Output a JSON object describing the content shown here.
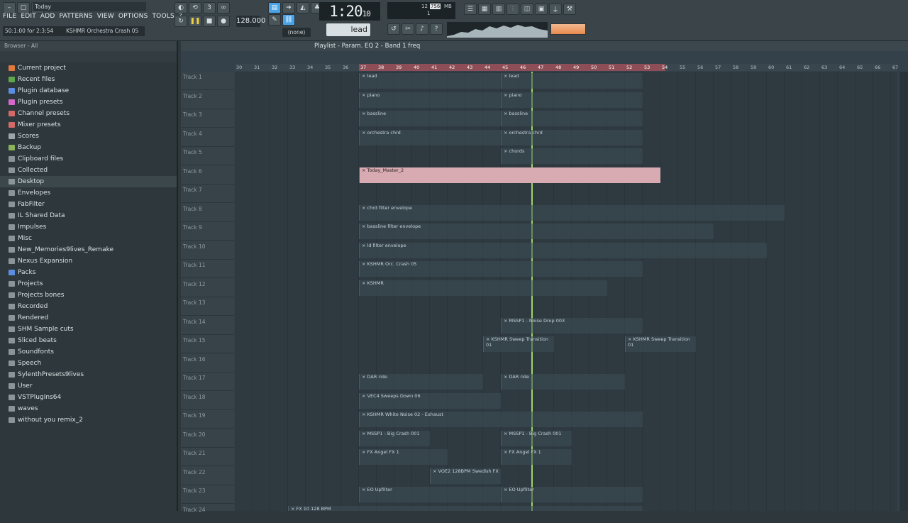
{
  "menu": [
    "FILE",
    "EDIT",
    "ADD",
    "PATTERNS",
    "VIEW",
    "OPTIONS",
    "TOOLS",
    "?"
  ],
  "mini_title": "Today",
  "hint": [
    "50:1:00 for 2:3:54",
    "KSHMR Orchestra Crash 05"
  ],
  "time": {
    "main": "1:20",
    "sub": "10"
  },
  "tempo": "128.000",
  "pattern": "lead",
  "none": "(none)",
  "cpu": {
    "a": "12",
    "b": "756",
    "c": "MB",
    "d": "1"
  },
  "browser": {
    "header": "Browser - All",
    "items": [
      {
        "label": "Current project",
        "color": "#e07a3c"
      },
      {
        "label": "Recent files",
        "color": "#5fa64f"
      },
      {
        "label": "Plugin database",
        "color": "#5b8ee0"
      },
      {
        "label": "Plugin presets",
        "color": "#d36acb"
      },
      {
        "label": "Channel presets",
        "color": "#d36a6a"
      },
      {
        "label": "Mixer presets",
        "color": "#d36a6a"
      },
      {
        "label": "Scores",
        "color": "#9aa6ab"
      },
      {
        "label": "Backup",
        "color": "#8bb35c"
      },
      {
        "label": "Clipboard files",
        "color": "#8b9599"
      },
      {
        "label": "Collected",
        "color": "#8b9599"
      },
      {
        "label": "Desktop",
        "color": "#8b9599"
      },
      {
        "label": "Envelopes",
        "color": "#8b9599"
      },
      {
        "label": "FabFilter",
        "color": "#8b9599"
      },
      {
        "label": "IL Shared Data",
        "color": "#8b9599"
      },
      {
        "label": "Impulses",
        "color": "#8b9599"
      },
      {
        "label": "Misc",
        "color": "#8b9599"
      },
      {
        "label": "New_Memories9lives_Remake",
        "color": "#8b9599"
      },
      {
        "label": "Nexus Expansion",
        "color": "#8b9599"
      },
      {
        "label": "Packs",
        "color": "#5b8ee0"
      },
      {
        "label": "Projects",
        "color": "#8b9599"
      },
      {
        "label": "Projects bones",
        "color": "#8b9599"
      },
      {
        "label": "Recorded",
        "color": "#8b9599"
      },
      {
        "label": "Rendered",
        "color": "#8b9599"
      },
      {
        "label": "SHM Sample cuts",
        "color": "#8b9599"
      },
      {
        "label": "Sliced beats",
        "color": "#8b9599"
      },
      {
        "label": "Soundfonts",
        "color": "#8b9599"
      },
      {
        "label": "Speech",
        "color": "#8b9599"
      },
      {
        "label": "SylenthPresets9lives",
        "color": "#8b9599"
      },
      {
        "label": "User",
        "color": "#8b9599"
      },
      {
        "label": "VSTPlugIns64",
        "color": "#8b9599"
      },
      {
        "label": "waves",
        "color": "#8b9599"
      },
      {
        "label": "without you remix_2",
        "color": "#8b9599"
      }
    ]
  },
  "playlist": {
    "title": "Playlist - Param. EQ 2 - Band 1 freq",
    "ruler": [
      "30",
      "31",
      "32",
      "33",
      "34",
      "35",
      "36",
      "37",
      "38",
      "39",
      "40",
      "41",
      "42",
      "43",
      "44",
      "45",
      "46",
      "47",
      "48",
      "49",
      "50",
      "51",
      "52",
      "53",
      "54",
      "55",
      "56",
      "57",
      "58",
      "59",
      "60",
      "61",
      "62",
      "63",
      "64",
      "65",
      "66",
      "67"
    ],
    "tracks": [
      "Track 1",
      "Track 2",
      "Track 3",
      "Track 4",
      "Track 5",
      "Track 6",
      "Track 7",
      "Track 8",
      "Track 9",
      "Track 10",
      "Track 11",
      "Track 12",
      "Track 13",
      "Track 14",
      "Track 15",
      "Track 16",
      "Track 17",
      "Track 18",
      "Track 19",
      "Track 20",
      "Track 21",
      "Track 22",
      "Track 23",
      "Track 24"
    ],
    "clips": [
      {
        "t": 0,
        "name": "lead",
        "a": 37,
        "b": 45
      },
      {
        "t": 0,
        "name": "lead",
        "a": 45,
        "b": 53
      },
      {
        "t": 1,
        "name": "piano",
        "a": 37,
        "b": 45
      },
      {
        "t": 1,
        "name": "piano",
        "a": 45,
        "b": 53
      },
      {
        "t": 2,
        "name": "bassline",
        "a": 37,
        "b": 45
      },
      {
        "t": 2,
        "name": "bassline",
        "a": 45,
        "b": 53
      },
      {
        "t": 3,
        "name": "orchestra chrd",
        "a": 37,
        "b": 45
      },
      {
        "t": 3,
        "name": "orchestra chrd",
        "a": 45,
        "b": 53
      },
      {
        "t": 4,
        "name": "chords",
        "a": 45,
        "b": 53
      },
      {
        "t": 5,
        "name": "Today_Master_2",
        "a": 37,
        "b": 54,
        "pink": true
      },
      {
        "t": 7,
        "name": "chrd filter envelope",
        "a": 37,
        "b": 61
      },
      {
        "t": 8,
        "name": "bassline filter envelope",
        "a": 37,
        "b": 57
      },
      {
        "t": 9,
        "name": "ld filter envelope",
        "a": 37,
        "b": 60
      },
      {
        "t": 10,
        "name": "KSHMR Orc. Crash 05",
        "a": 37,
        "b": 53
      },
      {
        "t": 11,
        "name": "KSHMR",
        "a": 37,
        "b": 51
      },
      {
        "t": 13,
        "name": "MSSP1 - Noise Drop 003",
        "a": 45,
        "b": 53
      },
      {
        "t": 14,
        "name": "KSHMR Sweep Transition 01",
        "a": 44,
        "b": 48
      },
      {
        "t": 14,
        "name": "KSHMR Sweep Transition 01",
        "a": 52,
        "b": 56
      },
      {
        "t": 16,
        "name": "DAR ride",
        "a": 37,
        "b": 44
      },
      {
        "t": 16,
        "name": "DAR ride",
        "a": 45,
        "b": 52
      },
      {
        "t": 17,
        "name": "VEC4 Sweeps Down 06",
        "a": 37,
        "b": 45
      },
      {
        "t": 18,
        "name": "KSHMR White Noise 02 - Exhaust",
        "a": 37,
        "b": 53
      },
      {
        "t": 19,
        "name": "MSSP1 - Big Crash 001",
        "a": 37,
        "b": 41
      },
      {
        "t": 19,
        "name": "MSSP1 - Big Crash 001",
        "a": 45,
        "b": 49
      },
      {
        "t": 20,
        "name": "FX Angel FX 1",
        "a": 37,
        "b": 42
      },
      {
        "t": 20,
        "name": "FX Angel FX 1",
        "a": 45,
        "b": 49
      },
      {
        "t": 21,
        "name": "VOE2 128BPM Swedish FX",
        "a": 41,
        "b": 45
      },
      {
        "t": 22,
        "name": "EO Upfilter",
        "a": 37,
        "b": 45
      },
      {
        "t": 22,
        "name": "EO Upfilter",
        "a": 45,
        "b": 53
      },
      {
        "t": 23,
        "name": "FX 10 128 BPM",
        "a": 33,
        "b": 53
      }
    ]
  }
}
